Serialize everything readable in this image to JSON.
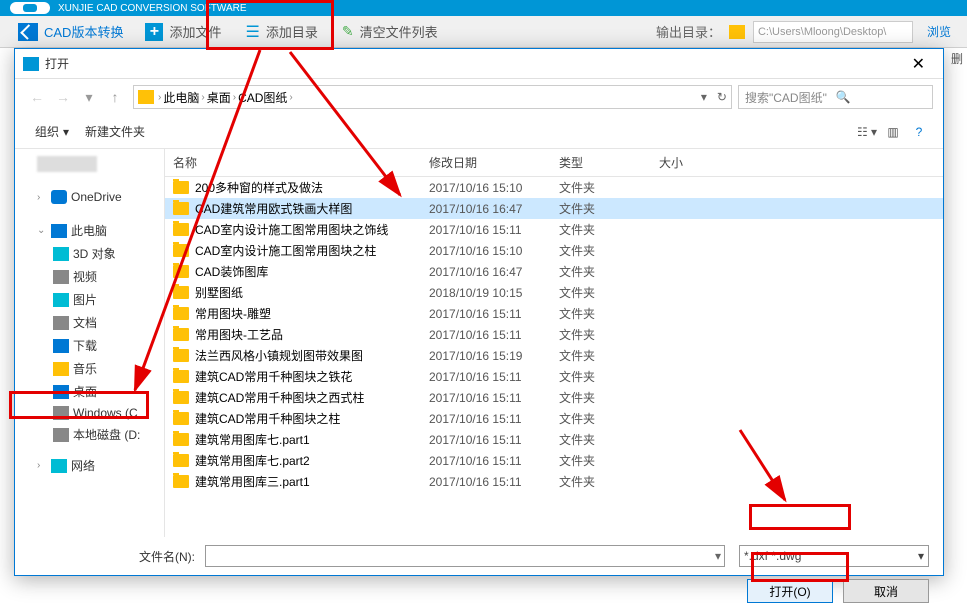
{
  "app": {
    "title": "XUNJIE CAD CONVERSION SOFTWARE",
    "convert_label": "CAD版本转换",
    "add_file_label": "添加文件",
    "add_dir_label": "添加目录",
    "clear_list_label": "清空文件列表",
    "output_label": "输出目录：",
    "output_path": "C:\\Users\\Mloong\\Desktop\\",
    "browse_label": "浏览",
    "delete_col": "删"
  },
  "dialog": {
    "title": "打开",
    "breadcrumb": {
      "root": "此电脑",
      "lvl1": "桌面",
      "lvl2": "CAD图纸"
    },
    "search_placeholder": "搜索\"CAD图纸\"",
    "cmd_organize": "组织",
    "cmd_newfolder": "新建文件夹",
    "sidebar": {
      "onedrive": "OneDrive",
      "thispc": "此电脑",
      "obj3d": "3D 对象",
      "video": "视频",
      "pictures": "图片",
      "documents": "文档",
      "downloads": "下载",
      "music": "音乐",
      "desktop": "桌面",
      "winc": "Windows (C",
      "locald": "本地磁盘 (D:",
      "network": "网络"
    },
    "columns": {
      "name": "名称",
      "date": "修改日期",
      "type": "类型",
      "size": "大小"
    },
    "files": [
      {
        "name": "200多种窗的样式及做法",
        "date": "2017/10/16 15:10",
        "type": "文件夹"
      },
      {
        "name": "CAD建筑常用欧式铁画大样图",
        "date": "2017/10/16 16:47",
        "type": "文件夹",
        "selected": true
      },
      {
        "name": "CAD室内设计施工图常用图块之饰线",
        "date": "2017/10/16 15:11",
        "type": "文件夹"
      },
      {
        "name": "CAD室内设计施工图常用图块之柱",
        "date": "2017/10/16 15:10",
        "type": "文件夹"
      },
      {
        "name": "CAD装饰图库",
        "date": "2017/10/16 16:47",
        "type": "文件夹"
      },
      {
        "name": "别墅图纸",
        "date": "2018/10/19 10:15",
        "type": "文件夹"
      },
      {
        "name": "常用图块-雕塑",
        "date": "2017/10/16 15:11",
        "type": "文件夹"
      },
      {
        "name": "常用图块-工艺品",
        "date": "2017/10/16 15:11",
        "type": "文件夹"
      },
      {
        "name": "法兰西风格小镇规划图带效果图",
        "date": "2017/10/16 15:19",
        "type": "文件夹"
      },
      {
        "name": "建筑CAD常用千种图块之铁花",
        "date": "2017/10/16 15:11",
        "type": "文件夹"
      },
      {
        "name": "建筑CAD常用千种图块之西式柱",
        "date": "2017/10/16 15:11",
        "type": "文件夹"
      },
      {
        "name": "建筑CAD常用千种图块之柱",
        "date": "2017/10/16 15:11",
        "type": "文件夹"
      },
      {
        "name": "建筑常用图库七.part1",
        "date": "2017/10/16 15:11",
        "type": "文件夹"
      },
      {
        "name": "建筑常用图库七.part2",
        "date": "2017/10/16 15:11",
        "type": "文件夹"
      },
      {
        "name": "建筑常用图库三.part1",
        "date": "2017/10/16 15:11",
        "type": "文件夹"
      }
    ],
    "filename_label": "文件名(N):",
    "filetype": "*.dxf *.dwg",
    "btn_open": "打开(O)",
    "btn_cancel": "取消"
  }
}
